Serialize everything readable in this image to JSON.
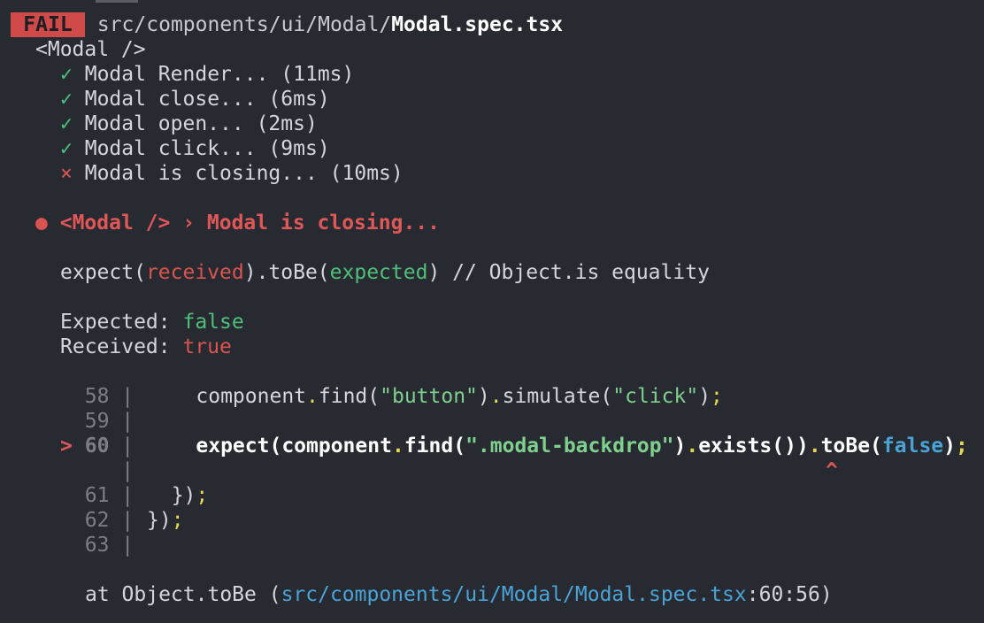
{
  "header": {
    "status_badge": "FAIL",
    "path_prefix": "src/components/ui/Modal/",
    "file_name": "Modal.spec.tsx"
  },
  "suite": {
    "name": "<Modal />",
    "tests": [
      {
        "icon": "✓",
        "status": "pass",
        "label": "Modal Render... (11ms)"
      },
      {
        "icon": "✓",
        "status": "pass",
        "label": "Modal close... (6ms)"
      },
      {
        "icon": "✓",
        "status": "pass",
        "label": "Modal open... (2ms)"
      },
      {
        "icon": "✓",
        "status": "pass",
        "label": "Modal click... (9ms)"
      },
      {
        "icon": "×",
        "status": "fail",
        "label": "Modal is closing... (10ms)"
      }
    ]
  },
  "failure": {
    "bullet": "●",
    "title": "<Modal /> › Modal is closing...",
    "matcher": {
      "prefix": "expect(",
      "received": "received",
      "middle": ").toBe(",
      "expected": "expected",
      "suffix": ") // Object.is equality"
    },
    "expected_label": "Expected: ",
    "expected_value": "false",
    "received_label": "Received: ",
    "received_value": "true"
  },
  "code": {
    "lines": [
      {
        "marker": " ",
        "num": "58",
        "sep": "|"
      },
      {
        "marker": " ",
        "num": "59",
        "sep": "|"
      },
      {
        "marker": ">",
        "num": "60",
        "sep": "|"
      },
      {
        "marker": " ",
        "num": "",
        "sep": "|"
      },
      {
        "marker": " ",
        "num": "61",
        "sep": "|"
      },
      {
        "marker": " ",
        "num": "62",
        "sep": "|"
      },
      {
        "marker": " ",
        "num": "63",
        "sep": "|"
      }
    ],
    "line58": {
      "indent": "    ",
      "obj": "component",
      "dot1": ".",
      "fn1": "find(",
      "str1": "\"button\"",
      "close1": ")",
      "dot2": ".",
      "fn2": "simulate(",
      "str2": "\"click\"",
      "close2": ")",
      "semi": ";"
    },
    "line60": {
      "indent": "    ",
      "a": "expect(component",
      "dot1": ".",
      "b": "find(",
      "str": "\".modal-backdrop\"",
      "c": ")",
      "dot2": ".",
      "d": "exists())",
      "dot3": ".",
      "e": "toBe(",
      "val": "false",
      "f": ")",
      "semi": ";"
    },
    "caret": "^",
    "line61": {
      "text": "  })",
      "semi": ";"
    },
    "line62": {
      "text": "})",
      "semi": ";"
    }
  },
  "stack": {
    "prefix": "at Object.toBe (",
    "path": "src/components/ui/Modal/Modal.spec.tsx",
    "loc": ":60:56)"
  },
  "colors": {
    "background": "#282a31",
    "fail_badge": "#d14a4a",
    "pass": "#4fbf7a",
    "fail": "#d9544f",
    "punctuation": "#e6d84a",
    "string": "#7fd08e",
    "keyword": "#4aa3d6"
  }
}
